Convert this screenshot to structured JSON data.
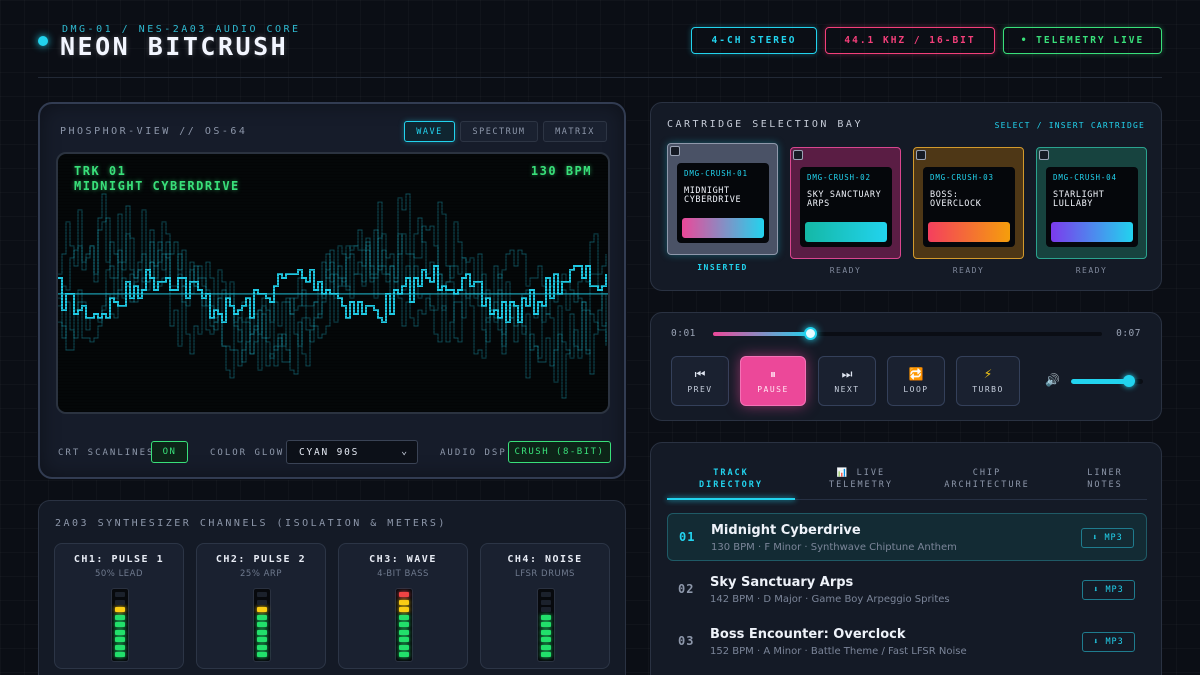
{
  "header": {
    "subtitle": "DMG-01 / NES-2A03 AUDIO CORE",
    "title": "NEON BITCRUSH",
    "badges": [
      {
        "label": "4-CH STEREO",
        "color": "#22d3ee"
      },
      {
        "label": "44.1 KHZ / 16-BIT",
        "color": "#f43f7a"
      },
      {
        "label": "• TELEMETRY LIVE",
        "color": "#39e07a"
      }
    ]
  },
  "viewer": {
    "label": "PHOSPHOR-VIEW // OS-64",
    "modes": [
      {
        "label": "WAVE",
        "active": true
      },
      {
        "label": "SPECTRUM",
        "active": false
      },
      {
        "label": "MATRIX",
        "active": false
      }
    ],
    "track_label": "TRK 01",
    "track_title": "MIDNIGHT CYBERDRIVE",
    "bpm": "130 BPM",
    "controls": {
      "scanlines_label": "CRT SCANLINES",
      "scanlines_value": "ON",
      "glow_label": "COLOR GLOW",
      "glow_value": "CYAN 90S",
      "dsp_label": "AUDIO DSP",
      "dsp_value": "CRUSH (8-BIT)"
    },
    "colors": {
      "wave": "#22d3ee",
      "text": "#39e07a"
    }
  },
  "synth": {
    "label": "2A03 SYNTHESIZER CHANNELS (ISOLATION & METERS)",
    "channels": [
      {
        "name": "CH1: PULSE 1",
        "sub": "50% LEAD",
        "level": 0.8
      },
      {
        "name": "CH2: PULSE 2",
        "sub": "25% ARP",
        "level": 0.8
      },
      {
        "name": "CH3: WAVE",
        "sub": "4-BIT BASS",
        "level": 1.0
      },
      {
        "name": "CH4: NOISE",
        "sub": "LFSR DRUMS",
        "level": 0.7
      }
    ]
  },
  "cartridges": {
    "label": "CARTRIDGE SELECTION BAY",
    "action": "SELECT / INSERT CARTRIDGE",
    "items": [
      {
        "id": "DMG-CRUSH-01",
        "name": "Midnight Cyberdrive",
        "status": "INSERTED",
        "shell": "#4a5266",
        "border": "#8f98ab",
        "grad": [
          "#ec4899",
          "#22d3ee"
        ],
        "inserted": true
      },
      {
        "id": "DMG-CRUSH-02",
        "name": "Sky Sanctuary Arps",
        "status": "READY",
        "shell": "#5a1d44",
        "border": "#d9468f",
        "grad": [
          "#14b8a6",
          "#22d3ee"
        ],
        "inserted": false
      },
      {
        "id": "DMG-CRUSH-03",
        "name": "Boss: Overclock",
        "status": "READY",
        "shell": "#4e3716",
        "border": "#d39a2c",
        "grad": [
          "#f43f5e",
          "#f59e0b"
        ],
        "inserted": false
      },
      {
        "id": "DMG-CRUSH-04",
        "name": "Starlight Lullaby",
        "status": "READY",
        "shell": "#17433f",
        "border": "#2ba38f",
        "grad": [
          "#7c3aed",
          "#22d3ee"
        ],
        "inserted": false
      }
    ]
  },
  "transport": {
    "time_current": "0:01",
    "time_total": "0:07",
    "progress": 0.25,
    "volume": 0.8,
    "buttons": [
      {
        "icon": "⏮",
        "label": "PREV",
        "name": "prev-button",
        "icon_name": "skip-back-icon",
        "active": false
      },
      {
        "icon": "⏸",
        "label": "PAUSE",
        "name": "pause-button",
        "icon_name": "pause-icon",
        "active": true
      },
      {
        "icon": "⏭",
        "label": "NEXT",
        "name": "next-button",
        "icon_name": "skip-forward-icon",
        "active": false
      },
      {
        "icon": "🔁",
        "label": "LOOP",
        "name": "loop-button",
        "icon_name": "loop-icon",
        "active": false
      },
      {
        "icon": "⚡",
        "label": "TURBO",
        "name": "turbo-button",
        "icon_name": "lightning-icon",
        "active": false
      }
    ],
    "volume_icon": "🔊"
  },
  "tracklist": {
    "tabs": [
      {
        "label": "TRACK\nDIRECTORY",
        "active": true
      },
      {
        "label": "📊 LIVE\nTELEMETRY",
        "active": false
      },
      {
        "label": "CHIP\nARCHITECTURE",
        "active": false
      },
      {
        "label": "LINER\nNOTES",
        "active": false
      }
    ],
    "tracks": [
      {
        "num": "01",
        "title": "Midnight Cyberdrive",
        "meta": "130 BPM · F Minor · Synthwave Chiptune Anthem",
        "download": "⬇ MP3",
        "active": true
      },
      {
        "num": "02",
        "title": "Sky Sanctuary Arps",
        "meta": "142 BPM · D Major · Game Boy Arpeggio Sprites",
        "download": "⬇ MP3",
        "active": false
      },
      {
        "num": "03",
        "title": "Boss Encounter: Overclock",
        "meta": "152 BPM · A Minor · Battle Theme / Fast LFSR Noise",
        "download": "⬇ MP3",
        "active": false
      }
    ]
  }
}
